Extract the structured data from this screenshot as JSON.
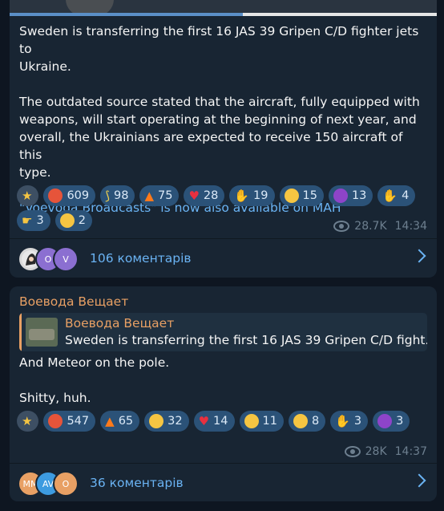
{
  "post1": {
    "text_line1": "Sweden is transferring the first 16 JAS 39 Gripen C/D fighter jets to",
    "text_line2": "Ukraine.",
    "text_line3": "The outdated source stated that the aircraft, fully equipped with",
    "text_line4": "weapons, will start operating at the beginning of next year, and",
    "text_line5": "overall, the Ukrainians are expected to receive 150 aircraft of this",
    "text_line6": "type.",
    "link_text": "\"Voevoda Broadcasts\" is now also available on MAH",
    "reactions": [
      {
        "icon": "star-icon",
        "count": ""
      },
      {
        "icon": "angry-face-icon",
        "count": "609"
      },
      {
        "icon": "banana-icon",
        "count": "98"
      },
      {
        "icon": "fire-icon",
        "count": "75"
      },
      {
        "icon": "heart-icon",
        "count": "28"
      },
      {
        "icon": "thumbs-up-icon",
        "count": "19"
      },
      {
        "icon": "grinning-face-icon",
        "count": "15"
      },
      {
        "icon": "devil-face-icon",
        "count": "13"
      },
      {
        "icon": "folded-hands-icon",
        "count": "4"
      },
      {
        "icon": "pointing-hand-icon",
        "count": "3"
      },
      {
        "icon": "rofl-face-icon",
        "count": "2"
      }
    ],
    "views": "28.7K",
    "time": "14:34",
    "avatars": [
      "",
      "O",
      "V"
    ],
    "comments": "106 коментарів"
  },
  "post2": {
    "author": "Воевода Вещает",
    "reply_author": "Воевода Вещает",
    "reply_text": "Sweden is transferring the first 16 JAS 39 Gripen C/D fight...",
    "text_line1": "And Meteor on the pole.",
    "text_line2": "Shitty, huh.",
    "reactions": [
      {
        "icon": "star-icon",
        "count": ""
      },
      {
        "icon": "angry-face-icon",
        "count": "547"
      },
      {
        "icon": "fire-icon",
        "count": "65"
      },
      {
        "icon": "grinning-face-icon",
        "count": "32"
      },
      {
        "icon": "heart-icon",
        "count": "14"
      },
      {
        "icon": "rofl-face-icon",
        "count": "11"
      },
      {
        "icon": "thinking-face-icon",
        "count": "8"
      },
      {
        "icon": "thumbs-up-icon",
        "count": "3"
      },
      {
        "icon": "devil-face-icon",
        "count": "3"
      }
    ],
    "views": "28K",
    "time": "14:37",
    "avatars": [
      "MM",
      "AV",
      "O"
    ],
    "comments": "36 коментарів"
  },
  "colors": {
    "background": "#0e1621",
    "bubble": "#182533",
    "reaction": "#2b5278",
    "link": "#6ab3f3",
    "author": "#e8a064"
  }
}
